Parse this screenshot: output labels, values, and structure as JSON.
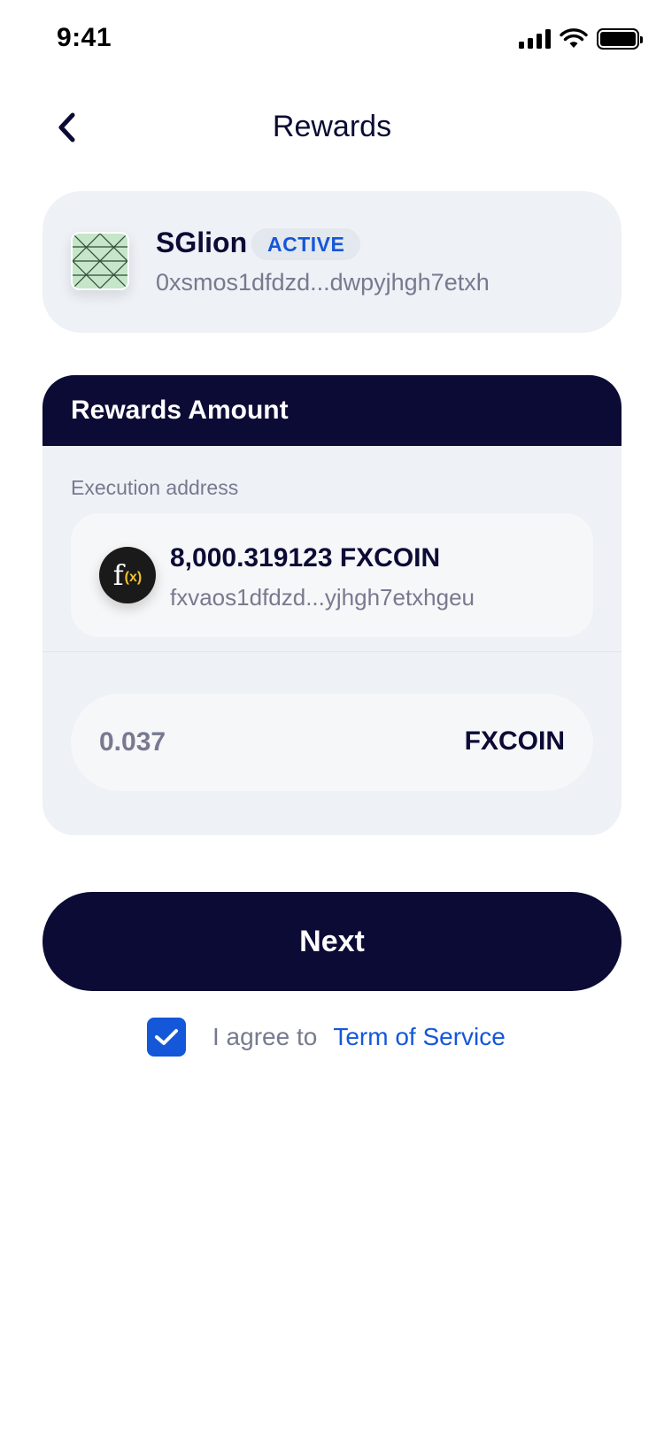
{
  "status_bar": {
    "time": "9:41",
    "icons": [
      "signal-icon",
      "wifi-icon",
      "battery-icon"
    ]
  },
  "header": {
    "title": "Rewards",
    "back_icon": "chevron-left-icon"
  },
  "validator": {
    "name": "SGlion",
    "status": "ACTIVE",
    "address": "0xsmos1dfdzd...dwpyjhgh7etxh",
    "avatar_icon": "validator-avatar-image"
  },
  "rewards": {
    "title": "Rewards Amount",
    "execution_label": "Execution address",
    "account": {
      "balance": "8,000.319123 FXCOIN",
      "address": "fxvaos1dfdzd...yjhgh7etxhgeu",
      "coin_icon": "fxcoin-icon"
    },
    "amount": {
      "placeholder": "0.037",
      "value": "",
      "unit": "FXCOIN"
    }
  },
  "actions": {
    "next_label": "Next"
  },
  "agreement": {
    "checked": true,
    "text": "I agree to",
    "link_text": "Term of Service"
  },
  "colors": {
    "primary_dark": "#0b0b35",
    "accent_blue": "#1457d8",
    "card_bg": "#eef1f5",
    "muted_text": "#777a8f"
  }
}
